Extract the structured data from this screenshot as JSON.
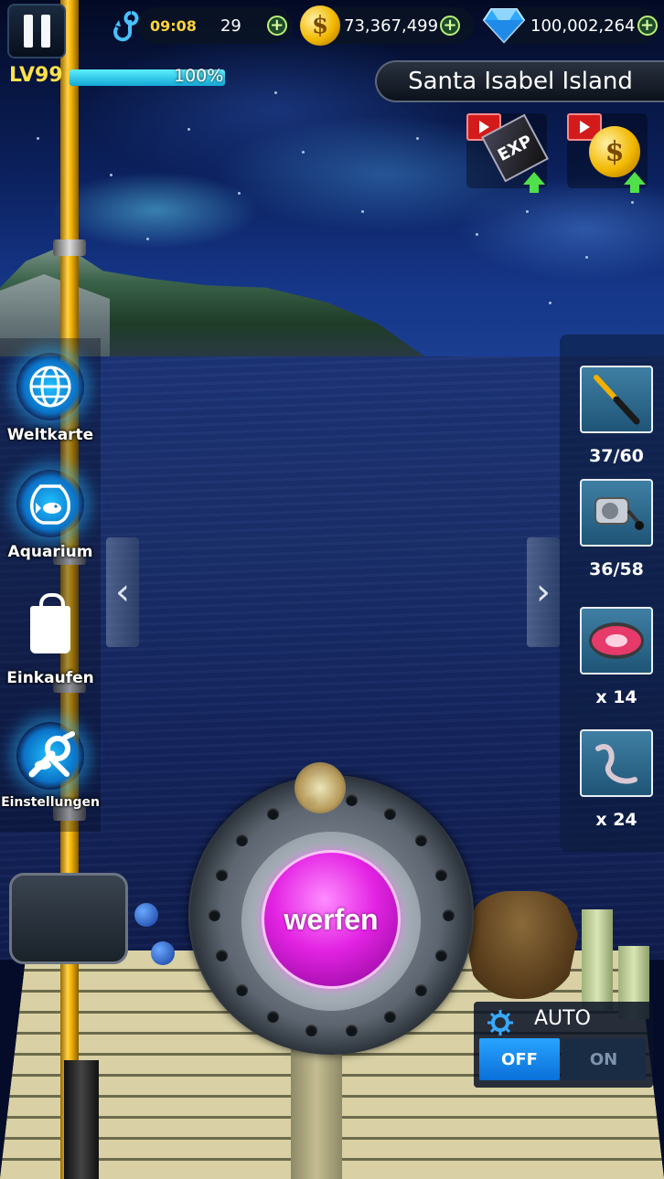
{
  "hud": {
    "time": "09:08",
    "bait_count": "29",
    "gold": "73,367,499",
    "gems": "100,002,264",
    "level": "LV99",
    "exp_percent": "100%",
    "exp_fraction": 1.0
  },
  "location": {
    "name": "Santa Isabel Island"
  },
  "video_rewards": {
    "exp_label": "EXP",
    "coin_symbol": "$"
  },
  "menu": {
    "items": [
      {
        "label": "Weltkarte",
        "icon": "globe-icon"
      },
      {
        "label": "Aquarium",
        "icon": "fishbowl-icon"
      },
      {
        "label": "Einkaufen",
        "icon": "shopping-bag-icon"
      },
      {
        "label": "Einstellungen",
        "icon": "settings-icon"
      }
    ]
  },
  "inventory": {
    "slots": [
      {
        "name": "rod",
        "icon": "fishing-rod-icon",
        "count": "37/60"
      },
      {
        "name": "reel",
        "icon": "reel-icon",
        "count": "36/58"
      },
      {
        "name": "line",
        "icon": "fishing-line-spool-icon",
        "count": "x 14"
      },
      {
        "name": "bait",
        "icon": "worm-bait-icon",
        "count": "x 24"
      }
    ]
  },
  "cast": {
    "label": "werfen"
  },
  "auto": {
    "label": "AUTO",
    "off_label": "OFF",
    "on_label": "ON",
    "state": "OFF"
  },
  "colors": {
    "cast_button": "#e323e3",
    "level_text": "#ffe14a",
    "exp_bar": "#14a8d6",
    "toggle_active": "#0a6fd8"
  }
}
